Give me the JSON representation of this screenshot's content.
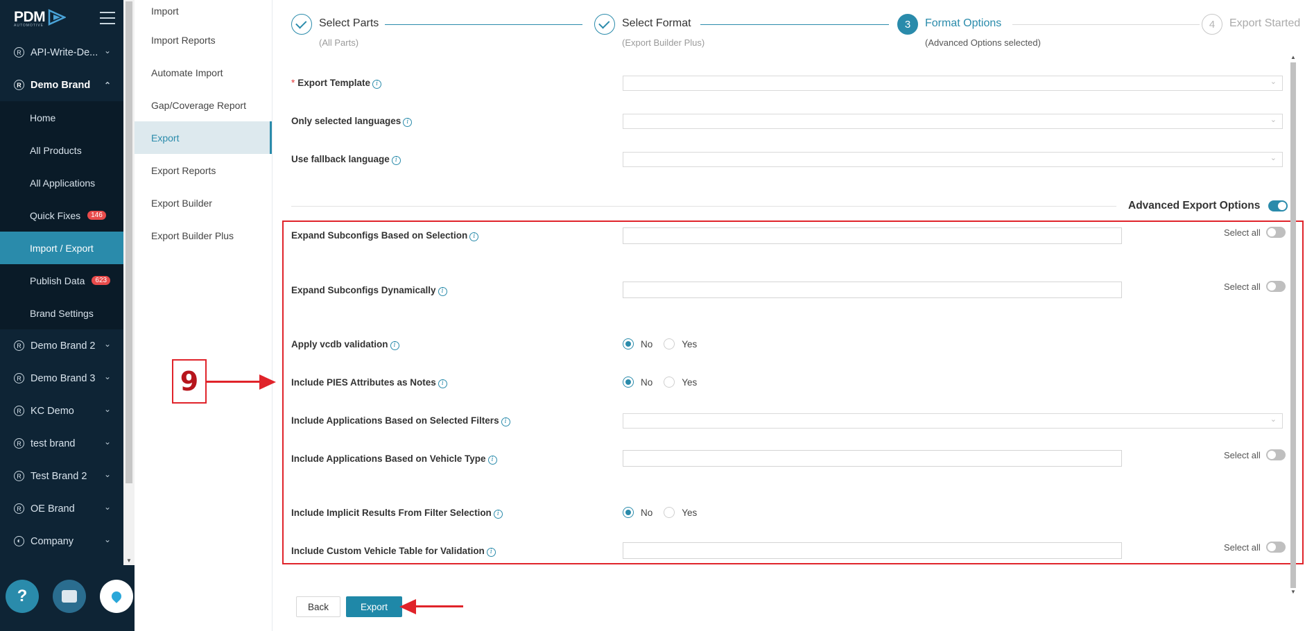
{
  "logo": {
    "text": "PDM",
    "sub": "AUTOMOTIVE"
  },
  "nav": {
    "items_top": [
      {
        "label": "API-Write-De..."
      },
      {
        "label": "Demo Brand"
      }
    ],
    "brand_sub": [
      {
        "label": "Home"
      },
      {
        "label": "All Products"
      },
      {
        "label": "All Applications"
      },
      {
        "label": "Quick Fixes",
        "badge": "146"
      },
      {
        "label": "Import / Export",
        "active": true
      },
      {
        "label": "Publish Data",
        "badge": "623"
      },
      {
        "label": "Brand Settings"
      }
    ],
    "items_bottom": [
      {
        "label": "Demo Brand 2"
      },
      {
        "label": "Demo Brand 3"
      },
      {
        "label": "KC Demo"
      },
      {
        "label": "test brand"
      },
      {
        "label": "Test Brand 2"
      },
      {
        "label": "OE Brand"
      },
      {
        "label": "Company"
      }
    ],
    "help_label": "?"
  },
  "submenu": [
    {
      "label": "Import"
    },
    {
      "label": "Import Reports"
    },
    {
      "label": "Automate Import"
    },
    {
      "label": "Gap/Coverage Report"
    },
    {
      "label": "Export",
      "active": true
    },
    {
      "label": "Export Reports"
    },
    {
      "label": "Export Builder"
    },
    {
      "label": "Export Builder Plus"
    }
  ],
  "steps": [
    {
      "title": "Select Parts",
      "desc": "(All Parts)",
      "state": "done"
    },
    {
      "title": "Select Format",
      "desc": "(Export Builder Plus)",
      "state": "done"
    },
    {
      "num": "3",
      "title": "Format Options",
      "desc": "(Advanced Options selected)",
      "state": "current"
    },
    {
      "num": "4",
      "title": "Export Started",
      "state": "pending"
    }
  ],
  "form": {
    "export_template": "Export Template",
    "required_mark": "*",
    "only_selected_languages": "Only selected languages",
    "use_fallback_language": "Use fallback language",
    "advanced_export_options": "Advanced Export Options",
    "expand_subconfigs_selection": "Expand Subconfigs Based on Selection",
    "expand_subconfigs_dynamically": "Expand Subconfigs Dynamically",
    "apply_vcdb_validation": "Apply vcdb validation",
    "include_pies_attributes": "Include PIES Attributes as Notes",
    "include_apps_selected_filters": "Include Applications Based on Selected Filters",
    "include_apps_vehicle_type": "Include Applications Based on Vehicle Type",
    "include_implicit_results": "Include Implicit Results From Filter Selection",
    "include_custom_vehicle_table": "Include Custom Vehicle Table for Validation",
    "select_all": "Select all",
    "no": "No",
    "yes": "Yes",
    "info": "i"
  },
  "buttons": {
    "back": "Back",
    "export": "Export"
  },
  "annotation": {
    "number": "9"
  },
  "colors": {
    "accent": "#2a8bab",
    "nav_bg": "#0e2435",
    "annotation_red": "#e0232a",
    "badge_red": "#e84b4b"
  }
}
